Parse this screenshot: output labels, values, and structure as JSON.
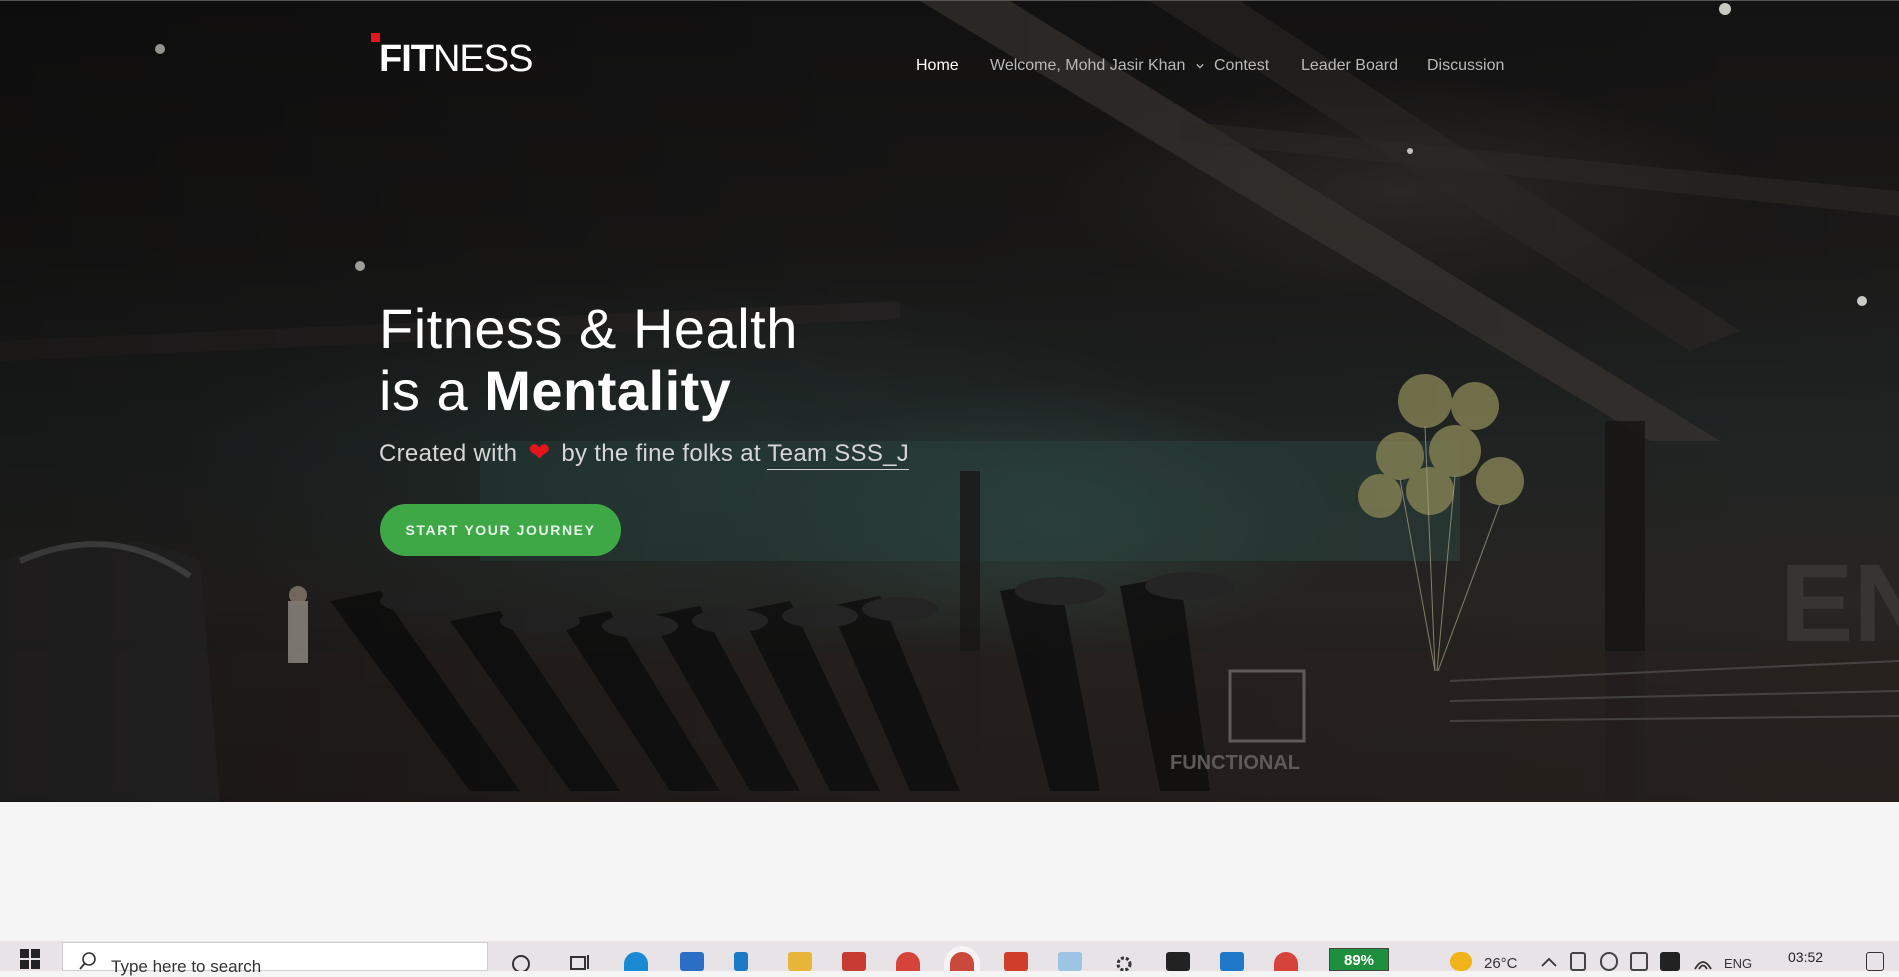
{
  "brand": {
    "logo_bold": "FIT",
    "logo_thin": "NESS"
  },
  "nav": {
    "items": [
      {
        "label": "Home",
        "active": true
      },
      {
        "label": "Welcome, Mohd Jasir Khan",
        "dropdown": true
      },
      {
        "label": "Contest"
      },
      {
        "label": "Leader Board"
      },
      {
        "label": "Discussion"
      }
    ]
  },
  "hero": {
    "line1": "Fitness & Health",
    "line2_prefix": "is a",
    "line2_strong": "Mentality",
    "sub_prefix": "Created with",
    "heart": "❤",
    "sub_middle": "by the fine folks at",
    "team": "Team SSS_J",
    "cta": "START YOUR JOURNEY"
  },
  "taskbar": {
    "search_placeholder": "Type here to search",
    "battery": "89%",
    "temperature": "26°C",
    "language": "ENG",
    "time": "03:52",
    "icons": [
      "windows-start-icon",
      "cortana-icon",
      "task-view-icon",
      "edge-icon",
      "mail-icon",
      "trello-icon",
      "file-explorer-icon",
      "gmail-icon",
      "chrome-icon",
      "chrome-active-icon",
      "office-icon",
      "notepad-icon",
      "settings-icon",
      "terminal-icon",
      "vscode-icon",
      "chrome-profile-icon"
    ],
    "colors": {
      "accent_green": "#3ea847",
      "heart_red": "#e3161b",
      "battery_green": "#1e8f3c"
    }
  }
}
